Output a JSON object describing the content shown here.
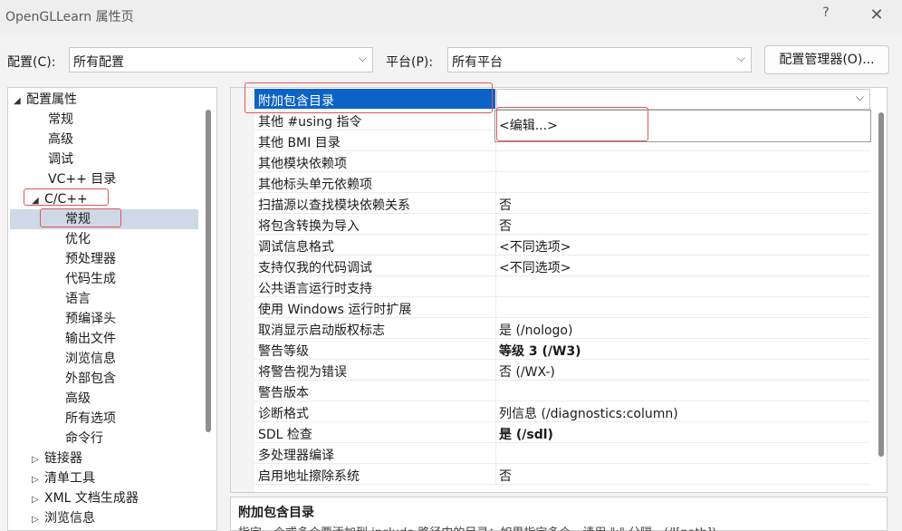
{
  "window": {
    "title": "OpenGLLearn 属性页",
    "help": "?",
    "close": "✕"
  },
  "config": {
    "config_label": "配置(C):",
    "config_value": "所有配置",
    "platform_label": "平台(P):",
    "platform_value": "所有平台",
    "manager_button": "配置管理器(O)..."
  },
  "tree": {
    "items": [
      {
        "label": "配置属性"
      },
      {
        "label": "常规"
      },
      {
        "label": "高级"
      },
      {
        "label": "调试"
      },
      {
        "label": "VC++ 目录"
      },
      {
        "label": "C/C++"
      },
      {
        "label": "常规"
      },
      {
        "label": "优化"
      },
      {
        "label": "预处理器"
      },
      {
        "label": "代码生成"
      },
      {
        "label": "语言"
      },
      {
        "label": "预编译头"
      },
      {
        "label": "输出文件"
      },
      {
        "label": "浏览信息"
      },
      {
        "label": "外部包含"
      },
      {
        "label": "高级"
      },
      {
        "label": "所有选项"
      },
      {
        "label": "命令行"
      },
      {
        "label": "链接器"
      },
      {
        "label": "清单工具"
      },
      {
        "label": "XML 文档生成器"
      },
      {
        "label": "浏览信息"
      }
    ]
  },
  "grid": {
    "rows": [
      {
        "name": "附加包含目录",
        "value": ""
      },
      {
        "name": "其他 #using 指令",
        "value": ""
      },
      {
        "name": "其他 BMI 目录",
        "value": ""
      },
      {
        "name": "其他模块依赖项",
        "value": ""
      },
      {
        "name": "其他标头单元依赖项",
        "value": ""
      },
      {
        "name": "扫描源以查找模块依赖关系",
        "value": "否"
      },
      {
        "name": "将包含转换为导入",
        "value": "否"
      },
      {
        "name": "调试信息格式",
        "value": "<不同选项>"
      },
      {
        "name": "支持仅我的代码调试",
        "value": "<不同选项>"
      },
      {
        "name": "公共语言运行时支持",
        "value": ""
      },
      {
        "name": "使用 Windows 运行时扩展",
        "value": ""
      },
      {
        "name": "取消显示启动版权标志",
        "value": "是 (/nologo)"
      },
      {
        "name": "警告等级",
        "value": "等级 3 (/W3)"
      },
      {
        "name": "将警告视为错误",
        "value": "否 (/WX-)"
      },
      {
        "name": "警告版本",
        "value": ""
      },
      {
        "name": "诊断格式",
        "value": "列信息 (/diagnostics:column)"
      },
      {
        "name": "SDL 检查",
        "value": "是 (/sdl)"
      },
      {
        "name": "多处理器编译",
        "value": ""
      },
      {
        "name": "启用地址擦除系统",
        "value": "否"
      }
    ],
    "dropdown_item": "<编辑...>"
  },
  "description": {
    "title": "附加包含目录",
    "text": "指定一个或多个要添加到 include 路径中的目录；如果指定多个，请用 \";\" 分隔。(/I[path])"
  }
}
